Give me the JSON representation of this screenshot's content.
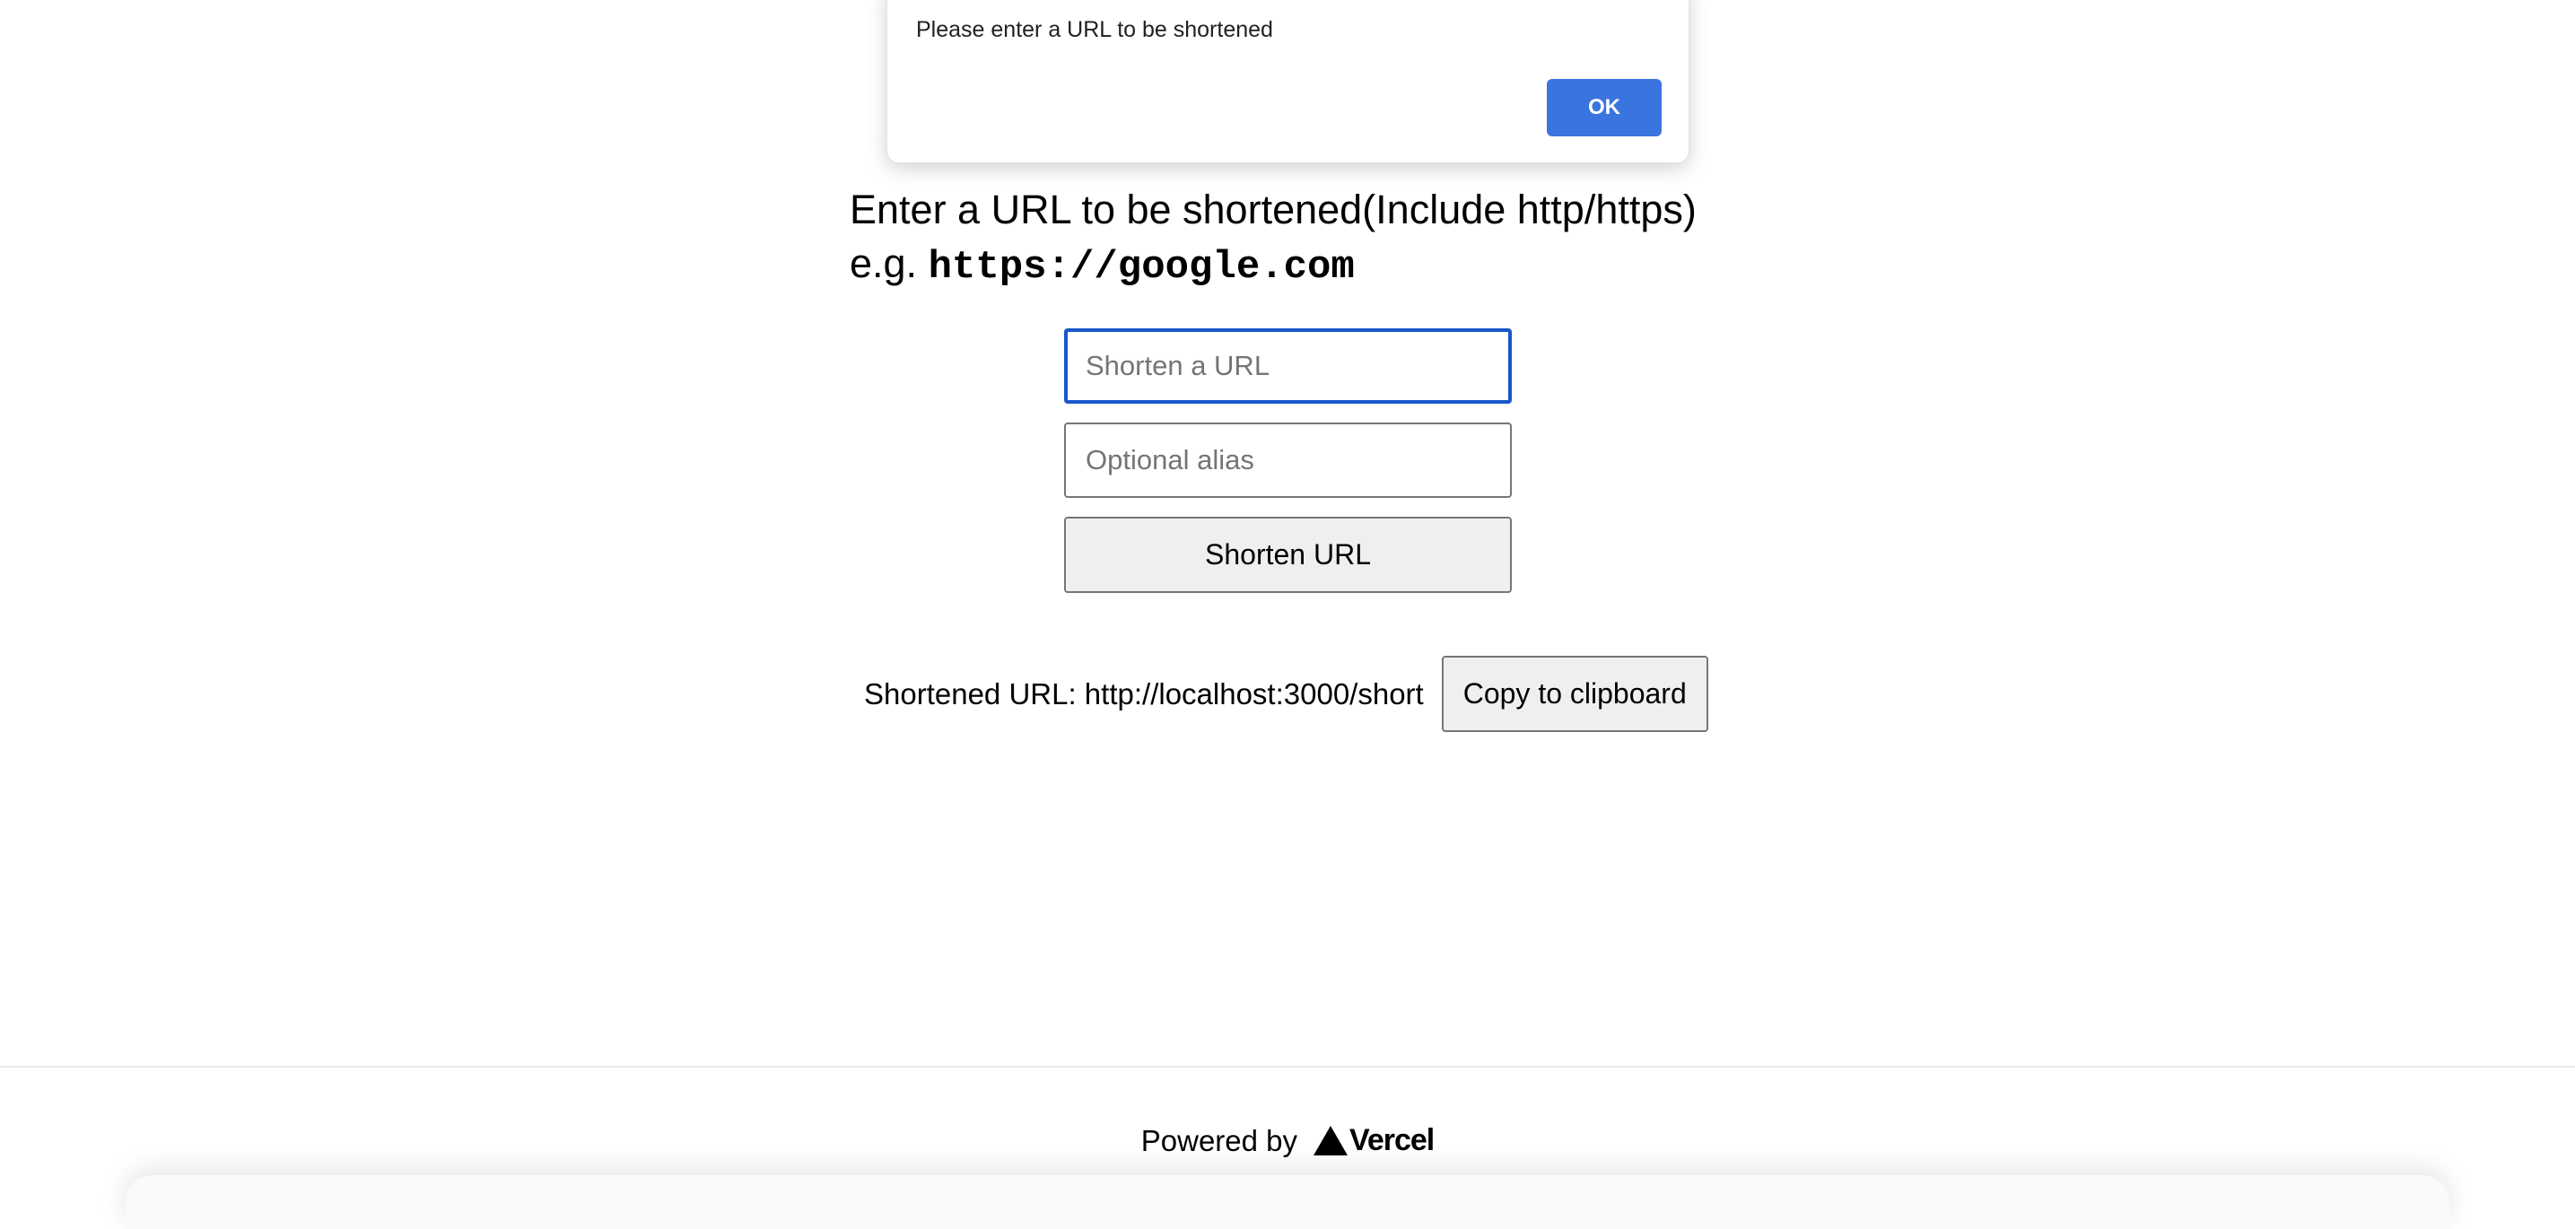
{
  "alert": {
    "message": "Please enter a URL to be shortened",
    "ok_label": "OK"
  },
  "heading": {
    "line1": "Enter a URL to be shortened(Include http/https)",
    "example_prefix": "e.g. ",
    "example_url": "https://google.com"
  },
  "form": {
    "url_placeholder": "Shorten a URL",
    "url_value": "",
    "alias_placeholder": "Optional alias",
    "alias_value": "",
    "submit_label": "Shorten URL"
  },
  "result": {
    "label": "Shortened URL: http://localhost:3000/short",
    "copy_label": "Copy to clipboard"
  },
  "footer": {
    "powered_by": "Powered by",
    "brand": "Vercel"
  },
  "colors": {
    "accent": "#3a74df",
    "focus_border": "#1a56c8"
  },
  "icons": {
    "vercel_logo": "vercel-triangle-icon"
  }
}
